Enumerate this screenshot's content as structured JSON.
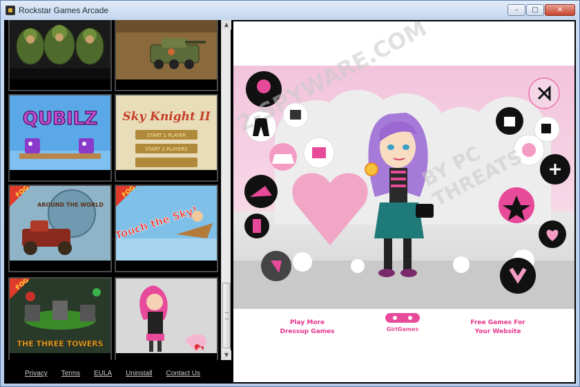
{
  "window": {
    "title": "Rockstar Games Arcade",
    "minimize": "–",
    "maximize": "□",
    "close": "✕"
  },
  "games": [
    {
      "name": "Army Soldiers",
      "badge": ""
    },
    {
      "name": "Tank Battle",
      "badge": ""
    },
    {
      "name": "Qubilz",
      "title": "QUBILZ",
      "badge": ""
    },
    {
      "name": "Sky Knight II",
      "title": "Sky Knight II",
      "buttons": [
        "START 1 PLAYER",
        "START 2 PLAYERS"
      ],
      "badge": ""
    },
    {
      "name": "Around the World",
      "title": "AROUND THE WORLD",
      "badge": "FOG"
    },
    {
      "name": "Touch the Sky",
      "title": "Touch the Sky!",
      "badge": "FOG"
    },
    {
      "name": "The Three Towers",
      "title": "THE THREE TOWERS",
      "badge": "FOG"
    },
    {
      "name": "Dress Up Girl",
      "badge": ""
    }
  ],
  "footer": {
    "privacy": "Privacy",
    "terms": "Terms",
    "eula": "EULA",
    "uninstall": "Uninstall",
    "contact": "Contact Us"
  },
  "content": {
    "left_promo": [
      "Play More",
      "Dressup Games"
    ],
    "right_promo": [
      "Free Games For",
      "Your Website"
    ],
    "logo_text": "GirlGames"
  },
  "watermark": {
    "text1": "2-SPYWARE.COM",
    "text2": "BY PC THREATS"
  },
  "colors": {
    "accent_pink": "#e4358e",
    "stage_pink": "#f2c4dc",
    "tile_border": "#4a4a4a"
  }
}
